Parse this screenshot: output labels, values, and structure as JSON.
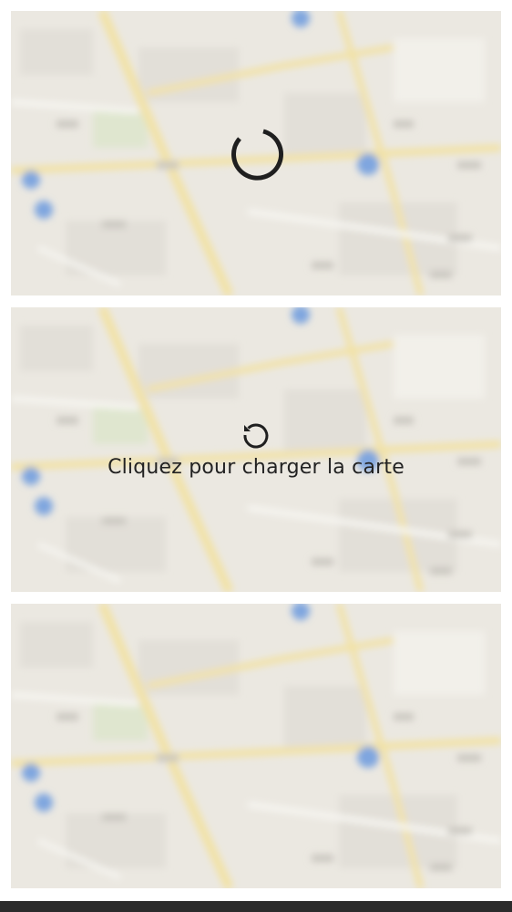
{
  "tiles": [
    {
      "state": "loading",
      "spinner_icon": "loading-spinner-icon"
    },
    {
      "state": "click-to-load",
      "reload_icon": "reload-icon",
      "label": "Cliquez pour charger la carte"
    },
    {
      "state": "idle"
    }
  ],
  "colors": {
    "map_base": "#ebe8e1",
    "road_yellow": "#f2e2a6",
    "road_white": "#f7f6f2",
    "block_gray": "#dcd9d2",
    "park_green": "#dfe6cf",
    "marker_blue": "#7fa6df",
    "icon_dark": "#1f1f1f",
    "bottom_bar": "#2b2b2b"
  }
}
